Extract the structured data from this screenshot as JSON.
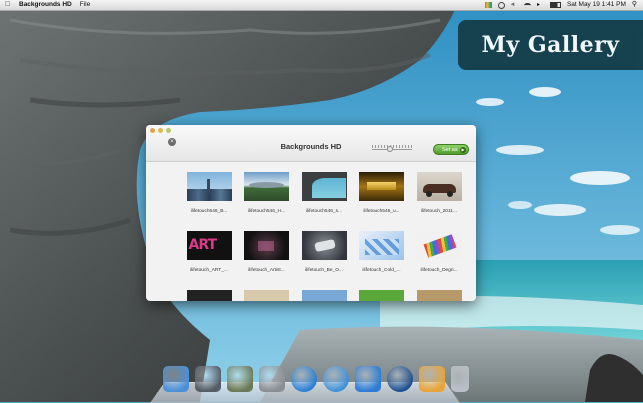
{
  "menubar": {
    "app_name": "Backgrounds HD",
    "menu_file": "File",
    "clock": "Sat May 19  1:41 PM"
  },
  "banner": {
    "text": "My Gallery"
  },
  "window": {
    "title": "Backgrounds HD",
    "set_button_label": "Set as",
    "size_slider_value": 0.45,
    "items": [
      {
        "caption": "ilifetouch546_B...",
        "kind": "city"
      },
      {
        "caption": "ilifetouch546_H...",
        "kind": "landscape"
      },
      {
        "caption": "ilifetouch546_s...",
        "kind": "cave"
      },
      {
        "caption": "ilifetouch546_u...",
        "kind": "gold"
      },
      {
        "caption": "ilifetouch_2011...",
        "kind": "car"
      },
      {
        "caption": "ilifetouch_ART_...",
        "kind": "art"
      },
      {
        "caption": "ilifetouch_Artist...",
        "kind": "dark"
      },
      {
        "caption": "ilifetouch_Be_O...",
        "kind": "apple"
      },
      {
        "caption": "ilifetouch_Cold_...",
        "kind": "cubes"
      },
      {
        "caption": "ilifetouch_Degri...",
        "kind": "pencils"
      },
      {
        "caption": "",
        "kind": "partial-dark"
      },
      {
        "caption": "",
        "kind": "partial-beige"
      },
      {
        "caption": "",
        "kind": "partial-blue"
      },
      {
        "caption": "",
        "kind": "partial-green"
      },
      {
        "caption": "",
        "kind": "partial-tan"
      }
    ]
  },
  "dock": {
    "items": [
      {
        "name": "finder-icon",
        "color": "#4a90d9"
      },
      {
        "name": "launchpad-icon",
        "color": "#555c66"
      },
      {
        "name": "mission-control-icon",
        "color": "#6b7a56"
      },
      {
        "name": "system-preferences-icon",
        "color": "#8a8f95"
      },
      {
        "name": "itunes-icon",
        "color": "#2a7fd4"
      },
      {
        "name": "safari-icon",
        "color": "#3f8fd9"
      },
      {
        "name": "app-store-icon",
        "color": "#2e7cd6"
      },
      {
        "name": "quicktime-icon",
        "color": "#1d4f8f"
      },
      {
        "name": "backgrounds-hd-icon",
        "color": "#e6a43a"
      },
      {
        "name": "trash-icon",
        "color": "#b9bfc6"
      }
    ]
  }
}
